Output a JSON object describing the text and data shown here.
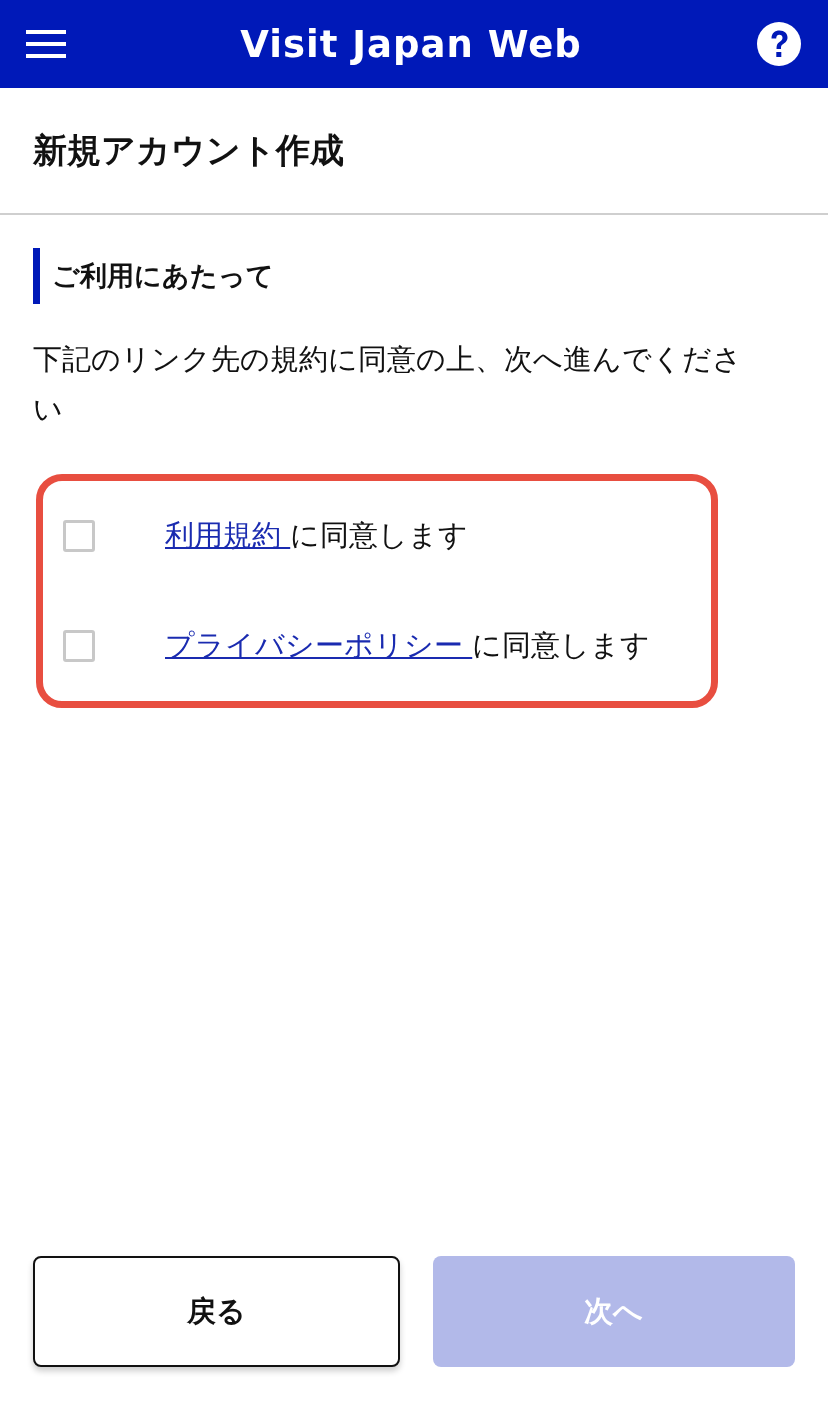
{
  "header": {
    "title": "Visit Japan Web"
  },
  "page_title": "新規アカウント作成",
  "section": {
    "heading": "ご利用にあたって",
    "description": "下記のリンク先の規約に同意の上、次へ進んでください"
  },
  "agreements": [
    {
      "link": "利用規約",
      "text": "に同意します",
      "checked": false
    },
    {
      "link": "プライバシーポリシー",
      "text": "に同意します",
      "checked": false
    }
  ],
  "highlighted": true,
  "buttons": [
    {
      "label": "戻る",
      "kind": "secondary",
      "disabled": false
    },
    {
      "label": "次へ",
      "kind": "primary",
      "disabled": true
    }
  ]
}
